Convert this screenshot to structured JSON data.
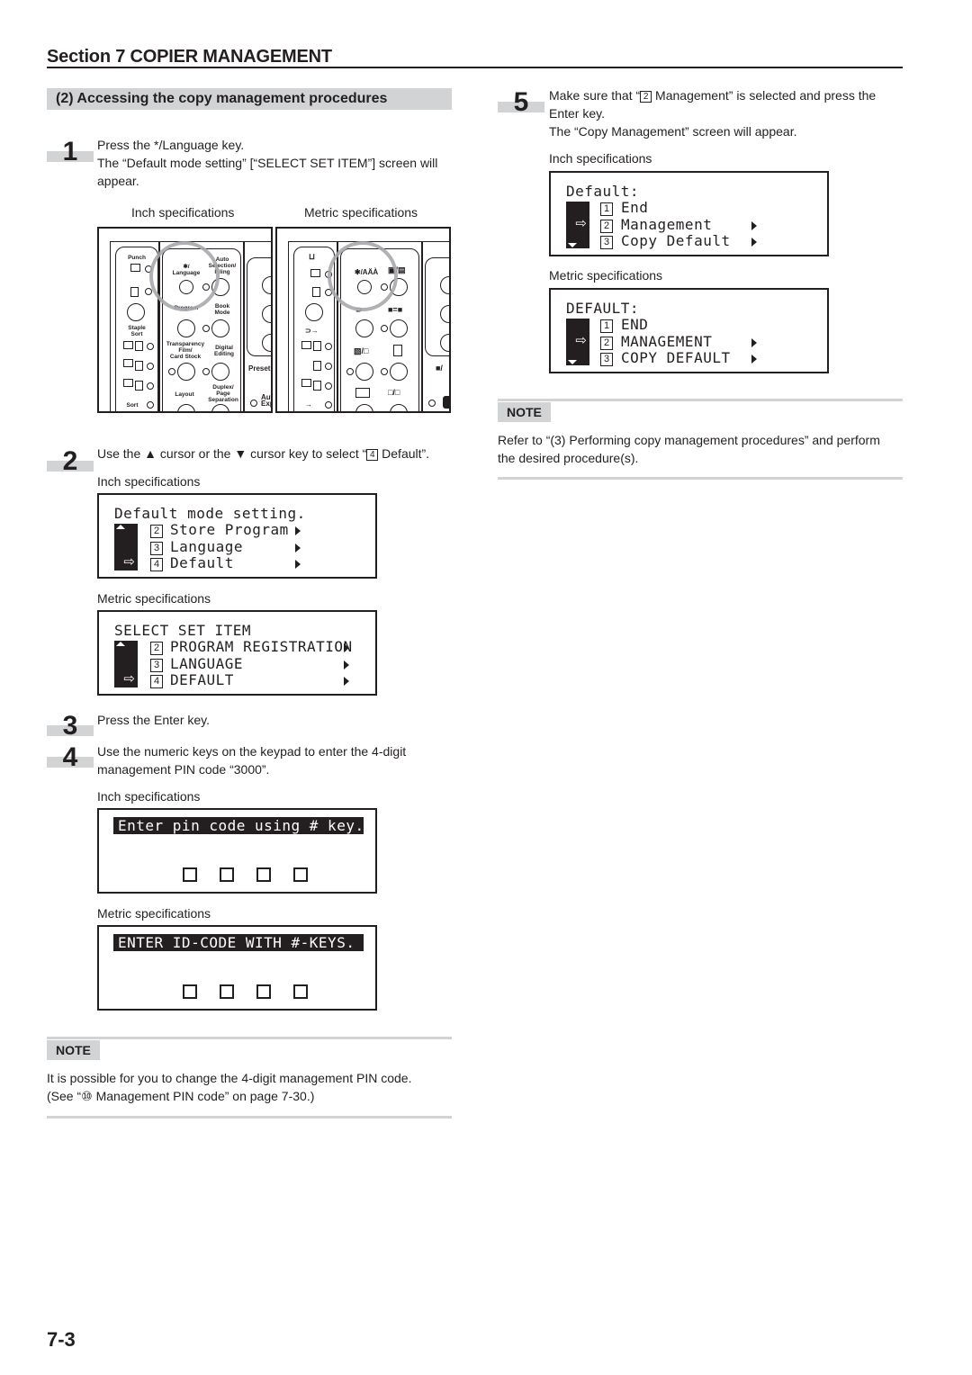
{
  "header": {
    "section_title": "Section 7  COPIER MANAGEMENT"
  },
  "subsection": {
    "title": "(2)  Accessing the copy management procedures"
  },
  "steps": [
    {
      "number": "1",
      "lines": [
        "Press the */Language key.",
        "The “Default mode setting” [“SELECT SET ITEM”] screen will",
        "appear."
      ]
    },
    {
      "number": "2",
      "text_before": "Use the ▲ cursor or the ▼ cursor key to select “",
      "keycap": "4",
      "text_after": " Default”."
    },
    {
      "number": "3",
      "text": "Press the Enter key."
    },
    {
      "number": "4",
      "lines": [
        "Use the numeric keys on the keypad to enter the 4-digit",
        "management PIN code “3000”."
      ]
    },
    {
      "number": "5",
      "text_before": "Make sure that “",
      "keycap": "2",
      "text_after": " Management” is selected and press the",
      "lines": [
        "Enter key.",
        "The “Copy Management” screen will appear."
      ]
    }
  ],
  "captions": {
    "inch": "Inch specifications",
    "metric": "Metric specifications"
  },
  "panels": {
    "inch": {
      "group1_title": "Punch",
      "group1_labels": [
        "Staple\nSort",
        "Sort"
      ],
      "group2_labels": {
        "language": "✱/\nLanguage",
        "auto_selection": "Auto\nSelection/\nFiling",
        "program": "Program",
        "book_mode": "Book\nMode",
        "transparency": "Transparency\nFilm/\nCard Stock",
        "digital_editing": "Digital\nEditing",
        "layout": "Layout",
        "duplex": "Duplex/\nPage\nSeparation"
      },
      "group3_labels": [
        "Preset",
        "Auto\nExp"
      ]
    },
    "metric": {
      "language_key": "✱/AÄÀ"
    }
  },
  "screens": {
    "step2_inch": {
      "title": "Default mode setting.",
      "rows": [
        {
          "num": "2",
          "label": "Store Program",
          "has_submenu": true
        },
        {
          "num": "3",
          "label": "Language",
          "has_submenu": true
        },
        {
          "num": "4",
          "label": "Default",
          "has_submenu": true,
          "selected": true
        }
      ]
    },
    "step2_metric": {
      "title": "SELECT SET ITEM",
      "rows": [
        {
          "num": "2",
          "label": "PROGRAM REGISTRATION",
          "has_submenu": true
        },
        {
          "num": "3",
          "label": "LANGUAGE",
          "has_submenu": true
        },
        {
          "num": "4",
          "label": "DEFAULT",
          "has_submenu": true,
          "selected": true
        }
      ]
    },
    "step4_inch": {
      "banner": "Enter pin code using # key.",
      "pin_slots": 4
    },
    "step4_metric": {
      "banner": "ENTER ID-CODE WITH #-KEYS.",
      "pin_slots": 4
    },
    "step5_inch": {
      "title": "Default:",
      "rows": [
        {
          "num": "1",
          "label": "End",
          "has_submenu": false
        },
        {
          "num": "2",
          "label": "Management",
          "has_submenu": true,
          "selected": true
        },
        {
          "num": "3",
          "label": "Copy Default",
          "has_submenu": true
        }
      ]
    },
    "step5_metric": {
      "title": "DEFAULT:",
      "rows": [
        {
          "num": "1",
          "label": "END",
          "has_submenu": false
        },
        {
          "num": "2",
          "label": "MANAGEMENT",
          "has_submenu": true,
          "selected": true
        },
        {
          "num": "3",
          "label": "COPY DEFAULT",
          "has_submenu": true
        }
      ]
    }
  },
  "notes": [
    {
      "label": "NOTE",
      "lines": [
        "It is possible for you to change the 4-digit management PIN code.",
        "(See “⑩ Management PIN code” on page 7-30.)"
      ]
    },
    {
      "label": "NOTE",
      "lines": [
        "Refer to “(3) Performing copy management procedures” and perform",
        "the desired procedure(s)."
      ]
    }
  ],
  "footer": {
    "page_number": "7-3"
  },
  "colors": {
    "text": "#231f20",
    "accent_gray": "#d1d3d4",
    "highlight_ring": "#a7a9ac"
  }
}
